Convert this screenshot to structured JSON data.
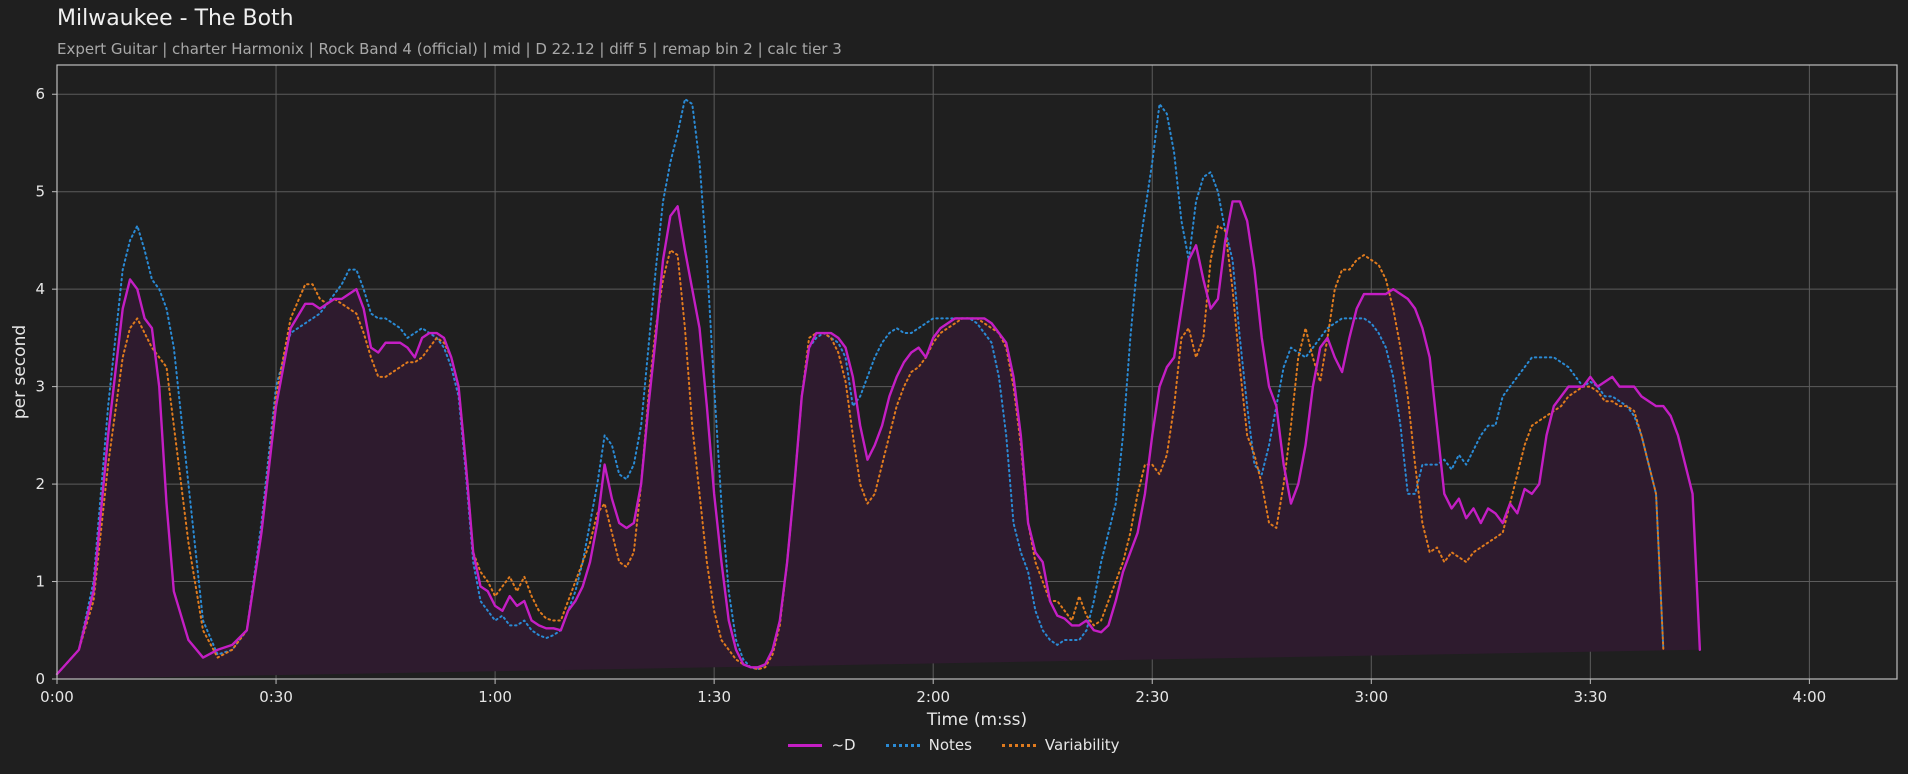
{
  "header": {
    "title": "Milwaukee - The Both",
    "subtitle": "Expert Guitar  |  charter Harmonix  |  Rock Band 4 (official)  |  mid  |  D 22.12  |  diff 5  |  remap bin 2  |  calc tier 3"
  },
  "colors": {
    "background": "#1f1f1f",
    "d": "#c41ec4",
    "notes": "#2a8ad4",
    "variability": "#e07b1e",
    "fill": "#2e1b2e",
    "grid": "#5c5c5c",
    "axis": "#bfbfbf"
  },
  "chart_data": {
    "type": "line",
    "xlabel": "Time (m:ss)",
    "ylabel": "per second",
    "xlim": [
      0,
      252
    ],
    "ylim": [
      0,
      6.3
    ],
    "x_ticks": [
      0,
      30,
      60,
      90,
      120,
      150,
      180,
      210,
      240
    ],
    "x_tick_labels": [
      "0:00",
      "0:30",
      "1:00",
      "1:30",
      "2:00",
      "2:30",
      "3:00",
      "3:30",
      "4:00"
    ],
    "y_ticks": [
      0,
      1,
      2,
      3,
      4,
      5,
      6
    ],
    "y_tick_labels": [
      "0",
      "1",
      "2",
      "3",
      "4",
      "5",
      "6"
    ],
    "grid": true,
    "legend_position": "bottom-center",
    "x": [
      0,
      3,
      5,
      7,
      9,
      10,
      11,
      12,
      13,
      14,
      15,
      16,
      18,
      20,
      22,
      24,
      26,
      28,
      30,
      32,
      34,
      35,
      36,
      37,
      38,
      39,
      40,
      41,
      42,
      43,
      44,
      45,
      46,
      47,
      48,
      49,
      50,
      51,
      52,
      53,
      54,
      55,
      56,
      57,
      58,
      59,
      60,
      61,
      62,
      63,
      64,
      65,
      66,
      67,
      68,
      69,
      70,
      71,
      72,
      73,
      74,
      75,
      76,
      77,
      78,
      79,
      80,
      81,
      82,
      83,
      84,
      85,
      86,
      87,
      88,
      89,
      90,
      91,
      92,
      93,
      94,
      95,
      96,
      97,
      98,
      99,
      100,
      101,
      102,
      103,
      104,
      105,
      106,
      107,
      108,
      109,
      110,
      111,
      112,
      113,
      114,
      115,
      116,
      117,
      118,
      119,
      120,
      121,
      122,
      123,
      124,
      125,
      126,
      127,
      128,
      129,
      130,
      131,
      132,
      133,
      134,
      135,
      136,
      137,
      138,
      139,
      140,
      141,
      142,
      143,
      144,
      145,
      146,
      147,
      148,
      149,
      150,
      151,
      152,
      153,
      154,
      155,
      156,
      157,
      158,
      159,
      160,
      161,
      162,
      163,
      164,
      165,
      166,
      167,
      168,
      169,
      170,
      171,
      172,
      173,
      174,
      175,
      176,
      177,
      178,
      179,
      180,
      181,
      182,
      183,
      184,
      185,
      186,
      187,
      188,
      189,
      190,
      191,
      192,
      193,
      194,
      195,
      196,
      197,
      198,
      199,
      200,
      201,
      202,
      203,
      204,
      205,
      206,
      207,
      208,
      209,
      210,
      211,
      212,
      213,
      214,
      215,
      216,
      217,
      218,
      219,
      220,
      221,
      222,
      223,
      224,
      225,
      226,
      227,
      228,
      229,
      230,
      231,
      232,
      233,
      234,
      235,
      236,
      237,
      238,
      239,
      240,
      241,
      242,
      243,
      244,
      245,
      246,
      247,
      248,
      249,
      250,
      251,
      252
    ],
    "series": [
      {
        "name": "~D",
        "style": "solid",
        "values": [
          0.05,
          0.3,
          0.9,
          2.5,
          3.8,
          4.1,
          4.0,
          3.7,
          3.6,
          3.0,
          1.8,
          0.9,
          0.4,
          0.22,
          0.3,
          0.35,
          0.5,
          1.5,
          2.8,
          3.6,
          3.85,
          3.85,
          3.8,
          3.85,
          3.9,
          3.9,
          3.95,
          4.0,
          3.8,
          3.4,
          3.35,
          3.45,
          3.45,
          3.45,
          3.4,
          3.3,
          3.5,
          3.55,
          3.55,
          3.5,
          3.3,
          3.0,
          2.2,
          1.3,
          0.95,
          0.9,
          0.75,
          0.7,
          0.85,
          0.75,
          0.8,
          0.6,
          0.55,
          0.52,
          0.52,
          0.5,
          0.7,
          0.8,
          0.95,
          1.2,
          1.6,
          2.2,
          1.85,
          1.6,
          1.55,
          1.6,
          2.0,
          2.8,
          3.5,
          4.3,
          4.75,
          4.85,
          4.4,
          4.0,
          3.6,
          2.8,
          1.9,
          1.2,
          0.6,
          0.3,
          0.15,
          0.12,
          0.12,
          0.15,
          0.3,
          0.6,
          1.2,
          2.0,
          2.9,
          3.4,
          3.55,
          3.55,
          3.55,
          3.5,
          3.4,
          3.1,
          2.6,
          2.25,
          2.4,
          2.6,
          2.9,
          3.1,
          3.25,
          3.35,
          3.4,
          3.3,
          3.5,
          3.6,
          3.65,
          3.7,
          3.7,
          3.7,
          3.7,
          3.7,
          3.65,
          3.55,
          3.45,
          3.1,
          2.5,
          1.6,
          1.3,
          1.2,
          0.8,
          0.65,
          0.62,
          0.55,
          0.55,
          0.6,
          0.5,
          0.48,
          0.55,
          0.8,
          1.1,
          1.3,
          1.5,
          1.9,
          2.5,
          3.0,
          3.2,
          3.3,
          3.8,
          4.3,
          4.45,
          4.1,
          3.8,
          3.9,
          4.5,
          4.9,
          4.9,
          4.7,
          4.2,
          3.5,
          3.0,
          2.8,
          2.2,
          1.8,
          2.0,
          2.4,
          3.0,
          3.4,
          3.5,
          3.3,
          3.15,
          3.5,
          3.8,
          3.95,
          3.95,
          3.95,
          3.95,
          4.0,
          3.95,
          3.9,
          3.8,
          3.6,
          3.3,
          2.6,
          1.9,
          1.75,
          1.85,
          1.65,
          1.75,
          1.6,
          1.75,
          1.7,
          1.6,
          1.8,
          1.7,
          1.95,
          1.9,
          2.0,
          2.5,
          2.8,
          2.9,
          3.0,
          3.0,
          3.0,
          3.1,
          3.0,
          3.05,
          3.1,
          3.0,
          3.0,
          3.0,
          2.9,
          2.85,
          2.8,
          2.8,
          2.7,
          2.5,
          2.2,
          1.9,
          0.3
        ]
      },
      {
        "name": "Notes",
        "style": "dotted",
        "values": [
          0.05,
          0.3,
          1.0,
          2.8,
          4.2,
          4.5,
          4.65,
          4.4,
          4.1,
          4.0,
          3.8,
          3.4,
          2.0,
          0.6,
          0.25,
          0.3,
          0.5,
          1.6,
          3.0,
          3.55,
          3.65,
          3.7,
          3.75,
          3.85,
          3.95,
          4.05,
          4.2,
          4.2,
          4.0,
          3.75,
          3.7,
          3.7,
          3.65,
          3.6,
          3.5,
          3.55,
          3.6,
          3.55,
          3.5,
          3.4,
          3.2,
          2.9,
          2.1,
          1.2,
          0.8,
          0.7,
          0.6,
          0.65,
          0.55,
          0.55,
          0.6,
          0.5,
          0.45,
          0.42,
          0.45,
          0.5,
          0.7,
          0.9,
          1.2,
          1.6,
          2.0,
          2.5,
          2.4,
          2.1,
          2.05,
          2.2,
          2.6,
          3.4,
          4.2,
          4.9,
          5.3,
          5.6,
          5.95,
          5.9,
          5.3,
          4.3,
          3.0,
          1.8,
          0.9,
          0.4,
          0.2,
          0.12,
          0.1,
          0.15,
          0.3,
          0.6,
          1.2,
          2.0,
          2.9,
          3.4,
          3.5,
          3.55,
          3.5,
          3.45,
          3.3,
          2.8,
          2.9,
          3.1,
          3.3,
          3.45,
          3.55,
          3.6,
          3.55,
          3.55,
          3.6,
          3.65,
          3.7,
          3.7,
          3.7,
          3.7,
          3.7,
          3.7,
          3.65,
          3.55,
          3.45,
          3.1,
          2.5,
          1.6,
          1.3,
          1.1,
          0.7,
          0.5,
          0.4,
          0.35,
          0.4,
          0.4,
          0.4,
          0.5,
          0.8,
          1.2,
          1.5,
          1.8,
          2.5,
          3.5,
          4.3,
          4.8,
          5.3,
          5.9,
          5.8,
          5.4,
          4.7,
          4.3,
          4.9,
          5.15,
          5.2,
          5.0,
          4.6,
          4.3,
          3.5,
          2.8,
          2.2,
          2.1,
          2.4,
          2.8,
          3.2,
          3.4,
          3.35,
          3.3,
          3.4,
          3.5,
          3.6,
          3.65,
          3.7,
          3.7,
          3.7,
          3.7,
          3.65,
          3.55,
          3.4,
          3.1,
          2.6,
          1.9,
          1.9,
          2.2,
          2.2,
          2.2,
          2.25,
          2.15,
          2.3,
          2.2,
          2.35,
          2.5,
          2.6,
          2.6,
          2.9,
          3.0,
          3.1,
          3.2,
          3.3,
          3.3,
          3.3,
          3.3,
          3.25,
          3.2,
          3.1,
          3.0,
          3.05,
          3.0,
          2.9,
          2.9,
          2.85,
          2.8,
          2.7,
          2.5,
          2.2,
          1.9,
          0.3
        ]
      },
      {
        "name": "Variability",
        "style": "dotted",
        "values": [
          0.05,
          0.3,
          0.8,
          2.2,
          3.3,
          3.6,
          3.7,
          3.55,
          3.4,
          3.3,
          3.2,
          2.6,
          1.4,
          0.5,
          0.22,
          0.3,
          0.5,
          1.5,
          2.9,
          3.7,
          4.05,
          4.05,
          3.9,
          3.85,
          3.9,
          3.85,
          3.8,
          3.75,
          3.55,
          3.3,
          3.1,
          3.1,
          3.15,
          3.2,
          3.25,
          3.25,
          3.3,
          3.4,
          3.5,
          3.45,
          3.3,
          3.0,
          2.2,
          1.3,
          1.1,
          1.0,
          0.85,
          0.95,
          1.05,
          0.9,
          1.05,
          0.85,
          0.7,
          0.62,
          0.6,
          0.6,
          0.8,
          1.0,
          1.2,
          1.4,
          1.7,
          1.8,
          1.5,
          1.2,
          1.15,
          1.3,
          2.0,
          2.9,
          3.6,
          4.1,
          4.4,
          4.35,
          3.6,
          2.6,
          1.9,
          1.2,
          0.7,
          0.4,
          0.3,
          0.2,
          0.15,
          0.12,
          0.1,
          0.12,
          0.25,
          0.55,
          1.2,
          2.0,
          2.9,
          3.5,
          3.55,
          3.55,
          3.5,
          3.35,
          3.05,
          2.5,
          2.0,
          1.8,
          1.9,
          2.2,
          2.5,
          2.8,
          3.0,
          3.15,
          3.2,
          3.3,
          3.45,
          3.55,
          3.6,
          3.65,
          3.7,
          3.7,
          3.7,
          3.65,
          3.6,
          3.55,
          3.4,
          3.0,
          2.4,
          1.6,
          1.2,
          1.0,
          0.8,
          0.8,
          0.7,
          0.6,
          0.85,
          0.65,
          0.55,
          0.6,
          0.8,
          1.0,
          1.2,
          1.5,
          1.9,
          2.2,
          2.2,
          2.1,
          2.3,
          2.8,
          3.5,
          3.6,
          3.3,
          3.5,
          4.3,
          4.65,
          4.6,
          4.0,
          3.2,
          2.5,
          2.3,
          2.0,
          1.6,
          1.55,
          2.0,
          2.6,
          3.3,
          3.6,
          3.3,
          3.05,
          3.5,
          4.0,
          4.2,
          4.2,
          4.3,
          4.35,
          4.3,
          4.25,
          4.1,
          3.8,
          3.4,
          2.9,
          2.2,
          1.6,
          1.3,
          1.35,
          1.2,
          1.3,
          1.25,
          1.2,
          1.3,
          1.35,
          1.4,
          1.45,
          1.5,
          1.8,
          2.1,
          2.4,
          2.6,
          2.65,
          2.7,
          2.75,
          2.8,
          2.9,
          2.95,
          3.0,
          3.0,
          2.95,
          2.85,
          2.85,
          2.8,
          2.8,
          2.75,
          2.5,
          2.2,
          1.9,
          0.3
        ]
      }
    ]
  }
}
